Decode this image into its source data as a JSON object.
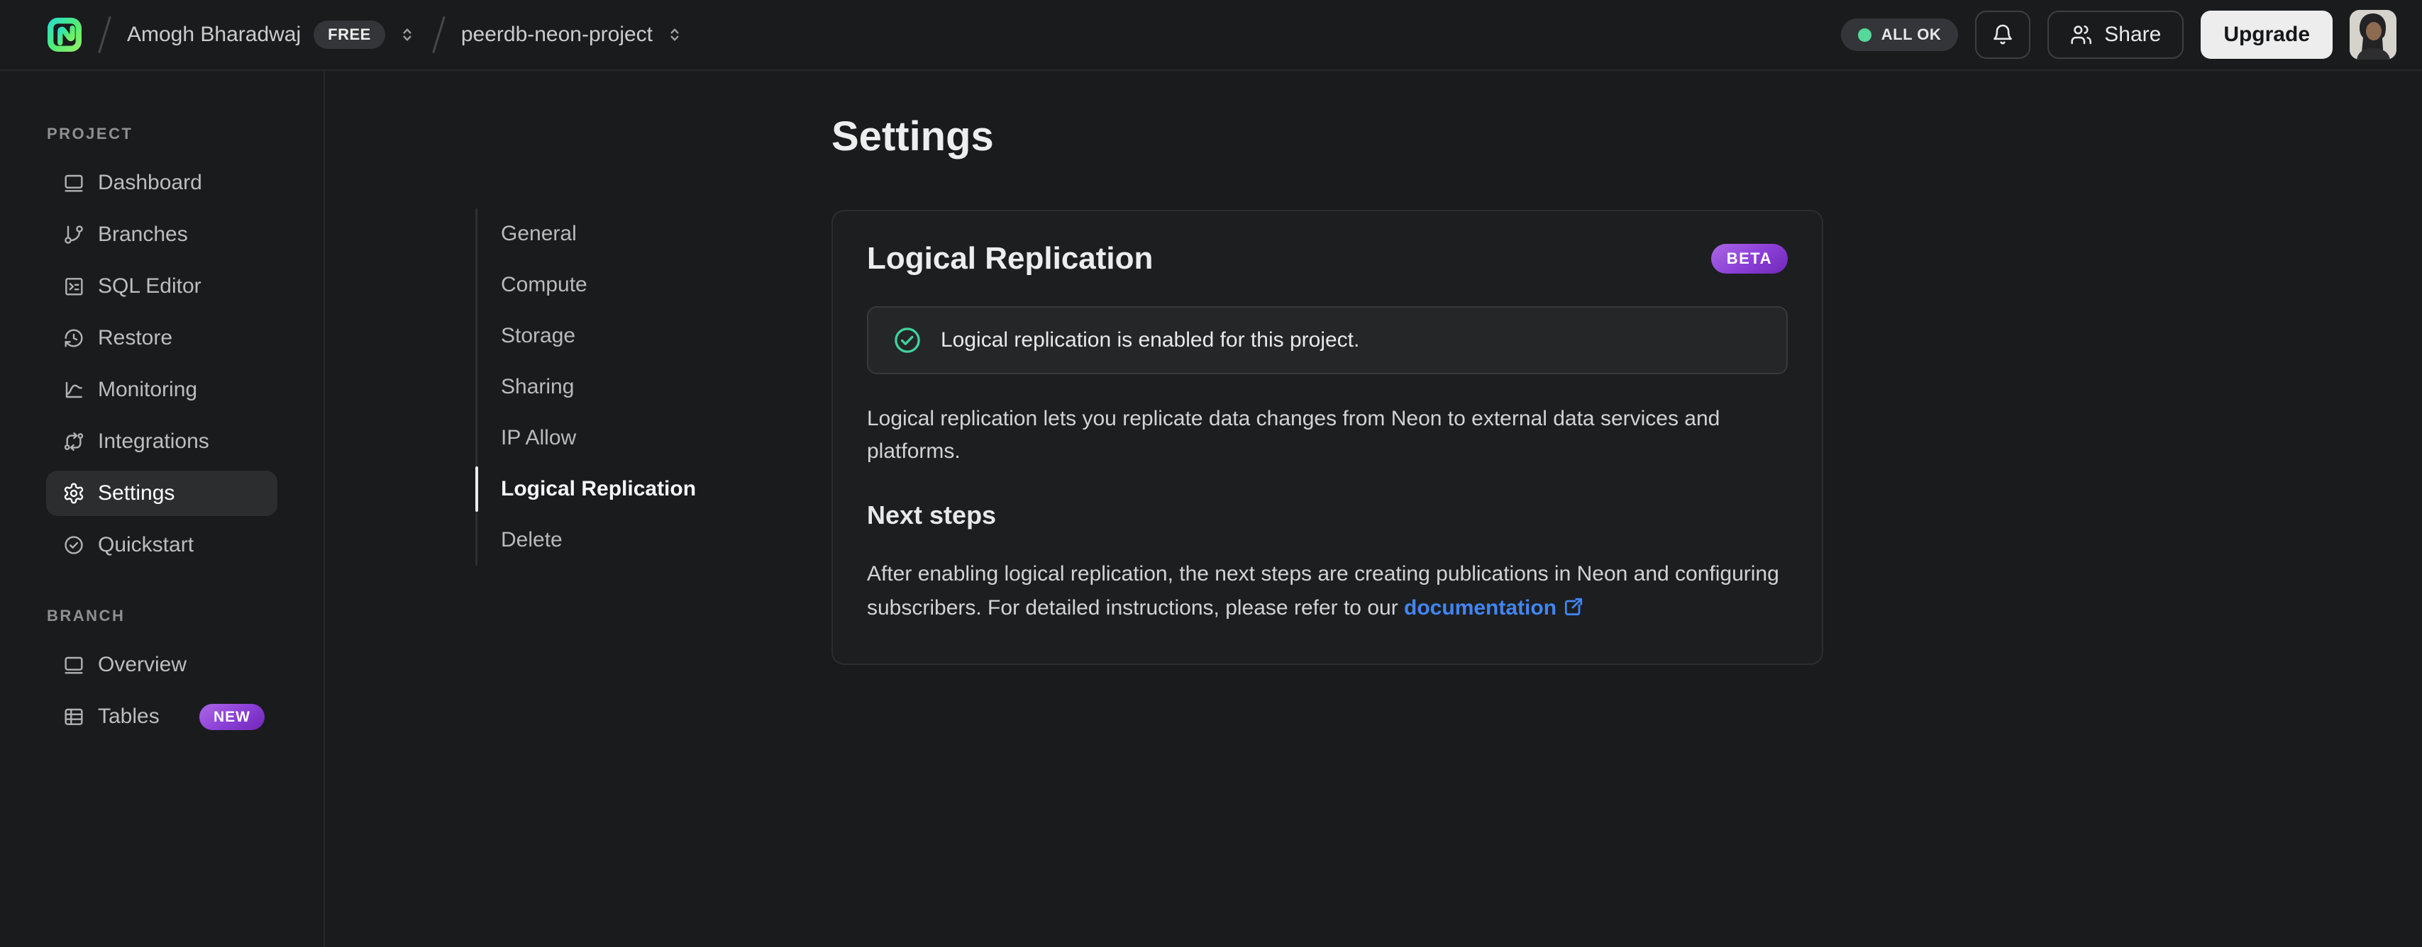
{
  "topbar": {
    "org_name": "Amogh Bharadwaj",
    "org_plan_badge": "FREE",
    "project_name": "peerdb-neon-project",
    "status_label": "ALL OK",
    "share_label": "Share",
    "upgrade_label": "Upgrade"
  },
  "sidebar": {
    "sections": [
      {
        "label": "PROJECT",
        "items": [
          {
            "label": "Dashboard"
          },
          {
            "label": "Branches"
          },
          {
            "label": "SQL Editor"
          },
          {
            "label": "Restore"
          },
          {
            "label": "Monitoring"
          },
          {
            "label": "Integrations"
          },
          {
            "label": "Settings",
            "active": true
          },
          {
            "label": "Quickstart"
          }
        ]
      },
      {
        "label": "BRANCH",
        "items": [
          {
            "label": "Overview"
          },
          {
            "label": "Tables",
            "badge": "NEW"
          }
        ]
      }
    ]
  },
  "settings_nav": {
    "items": [
      {
        "label": "General"
      },
      {
        "label": "Compute"
      },
      {
        "label": "Storage"
      },
      {
        "label": "Sharing"
      },
      {
        "label": "IP Allow"
      },
      {
        "label": "Logical Replication",
        "active": true
      },
      {
        "label": "Delete"
      }
    ]
  },
  "main": {
    "page_title": "Settings",
    "card": {
      "title": "Logical Replication",
      "badge": "BETA",
      "alert_text": "Logical replication is enabled for this project.",
      "description": "Logical replication lets you replicate data changes from Neon to external data services and platforms.",
      "next_steps_title": "Next steps",
      "next_steps_text": "After enabling logical replication, the next steps are creating publications in Neon and configuring subscribers. For detailed instructions, please refer to our ",
      "doc_link_label": "documentation"
    }
  },
  "colors": {
    "accent_green": "#56d998",
    "badge_purple_start": "#ab67e5",
    "badge_purple_end": "#7128b8",
    "link_blue": "#4285f4",
    "background": "#1a1b1d"
  }
}
